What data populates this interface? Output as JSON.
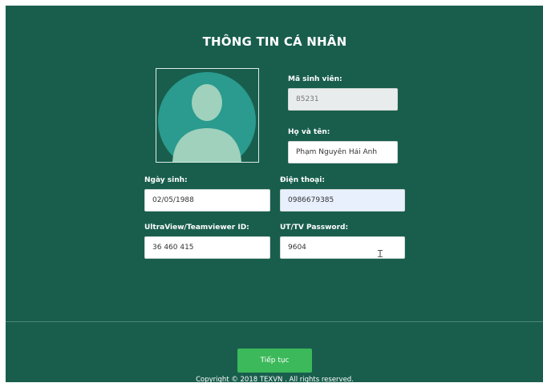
{
  "form": {
    "title": "THÔNG TIN CÁ NHÂN",
    "student_id": {
      "label": "Mã sinh viên:",
      "value": "85231"
    },
    "full_name": {
      "label": "Họ và tên:",
      "value": "Phạm Nguyễn Hải Anh"
    },
    "birth_date": {
      "label": "Ngày sinh:",
      "value": "02/05/1988"
    },
    "phone": {
      "label": "Điện thoại:",
      "value": "0986679385"
    },
    "remote_id": {
      "label": "UltraView/Teamviewer ID:",
      "value": "36 460 415"
    },
    "remote_password": {
      "label": "UT/TV Password:",
      "value": "9604"
    },
    "continue_label": "Tiếp tục"
  },
  "footer": {
    "copyright": "Copyright © 2018 TEXVN . All rights reserved."
  },
  "avatar": {
    "icon": "user-silhouette-icon"
  },
  "colors": {
    "panel_bg": "#195e4d",
    "avatar_bg": "#2a9b8e",
    "silhouette": "#9fd1bd",
    "button": "#3cb95a"
  }
}
